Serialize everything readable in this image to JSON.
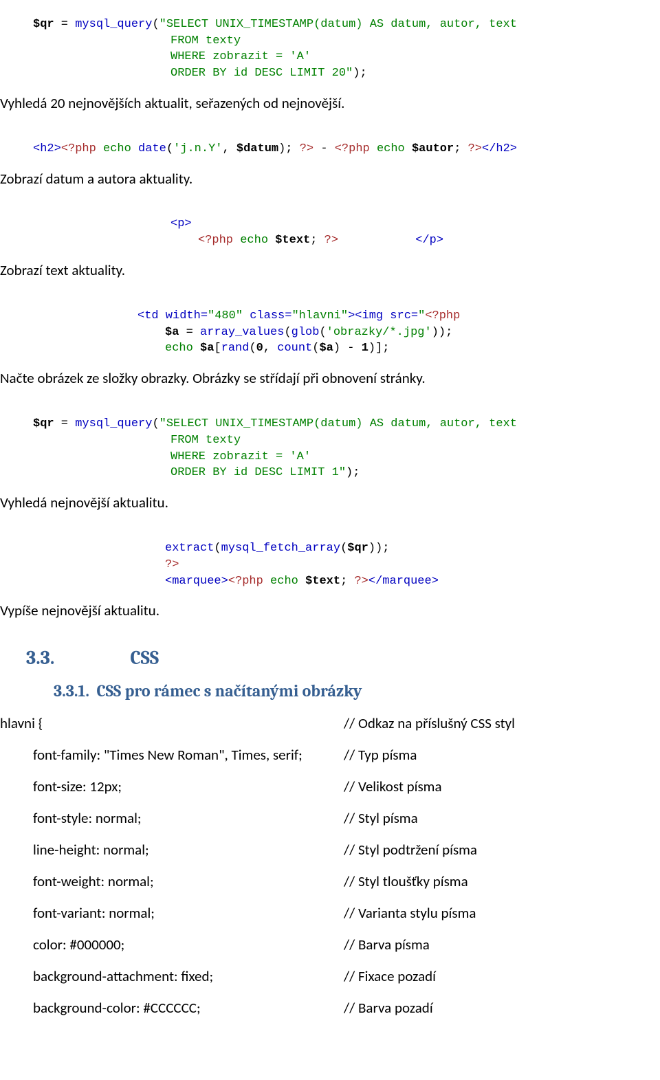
{
  "code1": {
    "l1_a": "$qr",
    "l1_b": " = ",
    "l1_c": "mysql_query",
    "l1_d": "(",
    "l1_e": "\"SELECT UNIX_TIMESTAMP(datum) AS datum, autor, text",
    "l2": "FROM texty",
    "l3": "WHERE zobrazit = 'A'",
    "l4_a": "ORDER BY id DESC LIMIT 20\"",
    "l4_b": ");"
  },
  "p1": "Vyhledá 20 nejnovějších aktualit, seřazených od nejnovější.",
  "code2": {
    "a": "<h2>",
    "b": "<?php ",
    "c": "echo ",
    "d": "date",
    "e": "(",
    "f": "'j.n.Y'",
    "g": ", ",
    "h": "$datum",
    "i": "); ",
    "j": "?>",
    "k": " - ",
    "l": "<?php ",
    "m": "echo ",
    "n": "$autor",
    "o": "; ",
    "p": "?>",
    "q": "</h2>"
  },
  "p2": "Zobrazí datum a autora aktuality.",
  "code3": {
    "l1": "<p>",
    "l2a": "<?php ",
    "l2b": "echo ",
    "l2c": "$text",
    "l2d": "; ",
    "l2e": "?>",
    "l2gap": "           ",
    "l3": "</p>"
  },
  "p3": "Zobrazí text aktuality.",
  "code4": {
    "l1a": "<td width=",
    "l1b": "\"480\"",
    "l1c": " class=",
    "l1d": "\"hlavni\"",
    "l1e": "><img src=",
    "l1f": "\"",
    "l1g": "<?php",
    "l2a": "$a",
    "l2b": " = ",
    "l2c": "array_values",
    "l2d": "(",
    "l2e": "glob",
    "l2f": "(",
    "l2g": "'obrazky/*.jpg'",
    "l2h": "));",
    "l3a": "echo ",
    "l3b": "$a",
    "l3c": "[",
    "l3d": "rand",
    "l3e": "(",
    "l3f": "0",
    "l3g": ", ",
    "l3h": "count",
    "l3i": "(",
    "l3j": "$a",
    "l3k": ") - ",
    "l3l": "1",
    "l3m": ")];"
  },
  "p4": "Načte obrázek ze složky obrazky. Obrázky se střídají při obnovení stránky.",
  "code5": {
    "l1a": "$qr",
    "l1b": " = ",
    "l1c": "mysql_query",
    "l1d": "(",
    "l1e": "\"SELECT UNIX_TIMESTAMP(datum) AS datum, autor, text",
    "l2": "FROM texty",
    "l3": "WHERE zobrazit = 'A'",
    "l4a": "ORDER BY id DESC LIMIT 1\"",
    "l4b": ");"
  },
  "p5": "Vyhledá nejnovější aktualitu.",
  "code6": {
    "l1a": "extract",
    "l1b": "(",
    "l1c": "mysql_fetch_array",
    "l1d": "(",
    "l1e": "$qr",
    "l1f": "));",
    "l2": "?>",
    "l3a": "<marquee>",
    "l3b": "<?php ",
    "l3c": "echo ",
    "l3d": "$text",
    "l3e": "; ",
    "l3f": "?>",
    "l3g": "</marquee>"
  },
  "p6": "Vypíše nejnovější aktualitu.",
  "h33_num": "3.3.",
  "h33_title": "CSS",
  "h331_num": "3.3.1.",
  "h331_title": "CSS pro rámec s načítanými obrázky",
  "css": {
    "rows": [
      {
        "l": "hlavni {",
        "r": "// Odkaz na příslušný CSS styl",
        "indent": false
      },
      {
        "l": "font-family: \"Times New Roman\", Times, serif;",
        "r": "// Typ písma",
        "indent": true
      },
      {
        "l": "font-size: 12px;",
        "r": " // Velikost písma",
        "indent": true
      },
      {
        "l": "font-style: normal;",
        "r": "// Styl písma",
        "indent": true
      },
      {
        "l": "line-height: normal;",
        "r": "// Styl podtržení písma",
        "indent": true
      },
      {
        "l": "font-weight: normal;",
        "r": "// Styl tloušťky písma",
        "indent": true
      },
      {
        "l": "font-variant: normal;",
        "r": "// Varianta stylu písma",
        "indent": true
      },
      {
        "l": "color: #000000;",
        "r": "// Barva písma",
        "indent": true
      },
      {
        "l": "background-attachment: fixed;",
        "r": "// Fixace pozadí",
        "indent": true
      },
      {
        "l": "background-color: #CCCCCC;",
        "r": "// Barva pozadí",
        "indent": true
      }
    ]
  }
}
